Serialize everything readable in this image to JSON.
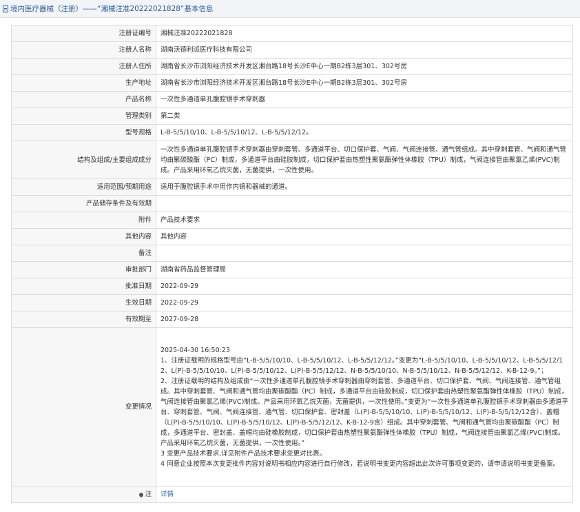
{
  "header": {
    "title": "境内医疗器械（注册）——“湘械注准20222021828”基本信息"
  },
  "rows": [
    {
      "label": "注册证编号",
      "value": "湘械注准20222021828"
    },
    {
      "label": "注册人名称",
      "value": "湖南沃德利派医疗科技有限公司"
    },
    {
      "label": "注册人住所",
      "value": "湖南省长沙市浏阳经济技术开发区湘台路18号长沙E中心一期B2栋3层301、302号房"
    },
    {
      "label": "生产地址",
      "value": "湖南省长沙市浏阳经济技术开发区湘台路18号长沙E中心一期B2栋3层301、302号房"
    },
    {
      "label": "产品名称",
      "value": "一次性多通道单孔腹腔镜手术穿刺器"
    },
    {
      "label": "管理类别",
      "value": "第二类"
    },
    {
      "label": "型号规格",
      "value": "L-B-5/5/10/10、L-B-5/5/10/12、L-B-5/5/12/12。"
    },
    {
      "label": "结构及组成/主要组成成分",
      "value": "一次性多通道单孔腹腔镜手术穿刺器由穿刺套管、多通道平台、切口保护套、气阀、气阀连接管、通气管组成。其中穿刺套管、气阀和通气管均由聚碳酸酯（PC）制成，多通道平台由硅胶制成，切口保护套由热塑性聚氨酯弹性体橡胶（TPU）制成，气阀连接管由聚氯乙烯(PVC)制成。产品采用环氧乙烷灭菌，无菌提供，一次性使用。"
    },
    {
      "label": "适用范围/预期用途",
      "value": "适用于腹腔镜手术中用作内镜和器械的通道。"
    },
    {
      "label": "产品储存条件及有效期",
      "value": ""
    },
    {
      "label": "附件",
      "value": "产品技术要求"
    },
    {
      "label": "其他内容",
      "value": "其他内容"
    },
    {
      "label": "备注",
      "value": ""
    },
    {
      "label": "审批部门",
      "value": "湖南省药品监督管理局"
    },
    {
      "label": "批准日期",
      "value": "2022-09-29"
    },
    {
      "label": "生效日期",
      "value": "2022-09-29"
    },
    {
      "label": "有效期至",
      "value": "2027-09-28"
    },
    {
      "label": "变更情况",
      "value": "2025-04-30 16:50:23\n1、注册证载明的规格型号由“L-B-5/5/10/10、L-B-5/5/10/12、L-B-5/5/12/12。”变更为“L-B-5/5/10/10、L-B-5/5/10/12、L-B-5/5/12/12、L(P)-B-5/5/10/10、L(P)-B-5/5/10/12、L(P)-B-5/5/12/12、N-B-5/5/10/10、N-B-5/5/10/12、N-B-5/5/12/12、K-B-12-9。”；\n2、注册证载明的结构及组成由“一次性多通道单孔腹腔镜手术穿刺器由穿刺套管、多通道平台、切口保护套、气阀、气阀连接管、通气管组成。其中穿刺套管、气阀和通气管均由聚碳酸酯（PC）制成，多通道平台由硅胶制成，切口保护套由热塑性聚氨酯弹性体橡胶（TPU）制成，气阀连接管由聚氯乙烯(PVC)制成。产品采用环氧乙烷灭菌，无菌提供，一次性使用。”变更为“一次性多通道单孔腹腔镜手术穿刺器由多通道平台、穿刺套管、气阀、气阀连接管、通气管、切口保护套、密封盖（L(P)-B-5/5/10/10、L(P)-B-5/5/10/12、L(P)-B-5/5/12/12含）、盖帽（L(P)-B-5/5/10/10、L(P)-B-5/5/10/12、L(P)-B-5/5/12/12、K-B-12-9含）组成。其中穿刺套管、气阀和通气管均由聚碳酸酯（PC）制成，多通道平台、密封盖、盖帽均由硅橡胶制成，切口保护套由热塑性聚氨酯弹性体橡胶（TPU）制成，气阀连接管由聚氯乙烯(PVC)制成。产品采用环氧乙烷灭菌，无菌提供，一次性使用。”\n3 变更产品技术要求,详见附件产品技术要求变更对比表。\n4 同意企业按照本次变更批件内容对说明书相应内容进行自行修改，若说明书变更内容超出此次许可事项变更的，请申请说明书变更备案。"
    }
  ],
  "note": {
    "label": "注",
    "link": "详情"
  }
}
